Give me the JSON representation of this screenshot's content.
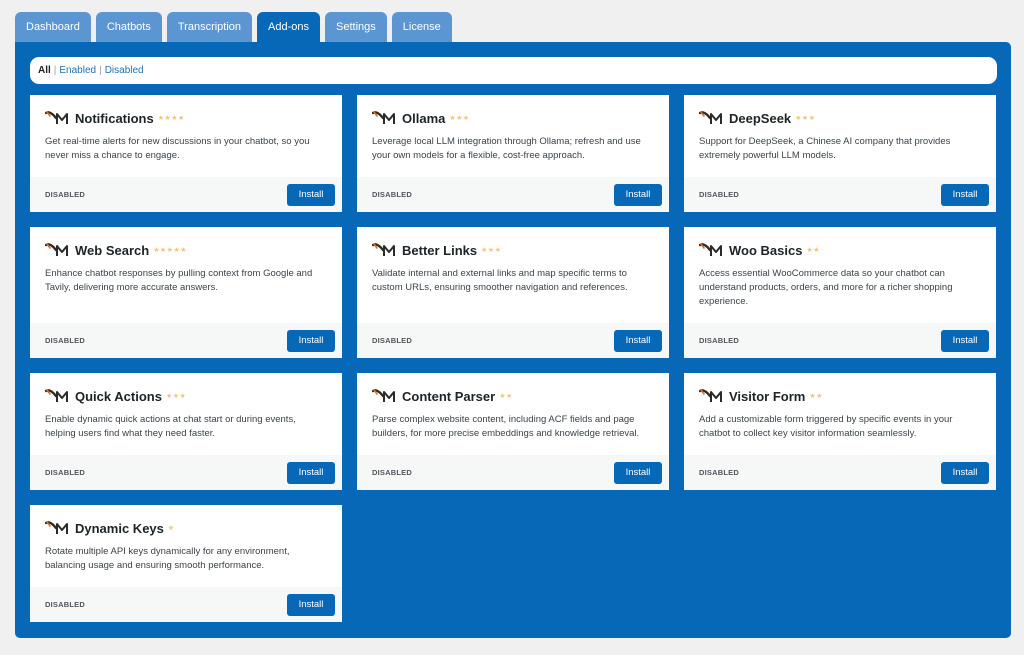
{
  "tabs": [
    {
      "label": "Dashboard",
      "active": false
    },
    {
      "label": "Chatbots",
      "active": false
    },
    {
      "label": "Transcription",
      "active": false
    },
    {
      "label": "Add-ons",
      "active": true
    },
    {
      "label": "Settings",
      "active": false
    },
    {
      "label": "License",
      "active": false
    }
  ],
  "filters": {
    "all": "All",
    "enabled": "Enabled",
    "disabled": "Disabled",
    "separator": "|"
  },
  "colors": {
    "accent": "#0868b8",
    "tab_inactive": "#5b95d2",
    "star": "#f0c674"
  },
  "addons": [
    {
      "title": "Notifications",
      "stars": "★★★★",
      "description": "Get real-time alerts for new discussions in your chatbot, so you never miss a chance to engage.",
      "status": "DISABLED",
      "action": "Install"
    },
    {
      "title": "Ollama",
      "stars": "★★★",
      "description": "Leverage local LLM integration through Ollama; refresh and use your own models for a flexible, cost-free approach.",
      "status": "DISABLED",
      "action": "Install"
    },
    {
      "title": "DeepSeek",
      "stars": "★★★",
      "description": "Support for DeepSeek, a Chinese AI company that provides extremely powerful LLM models.",
      "status": "DISABLED",
      "action": "Install"
    },
    {
      "title": "Web Search",
      "stars": "★★★★★",
      "description": "Enhance chatbot responses by pulling context from Google and Tavily, delivering more accurate answers.",
      "status": "DISABLED",
      "action": "Install"
    },
    {
      "title": "Better Links",
      "stars": "★★★",
      "description": "Validate internal and external links and map specific terms to custom URLs, ensuring smoother navigation and references.",
      "status": "DISABLED",
      "action": "Install"
    },
    {
      "title": "Woo Basics",
      "stars": "★★",
      "description": "Access essential WooCommerce data so your chatbot can understand products, orders, and more for a richer shopping experience.",
      "status": "DISABLED",
      "action": "Install"
    },
    {
      "title": "Quick Actions",
      "stars": "★★★",
      "description": "Enable dynamic quick actions at chat start or during events, helping users find what they need faster.",
      "status": "DISABLED",
      "action": "Install"
    },
    {
      "title": "Content Parser",
      "stars": "★★",
      "description": "Parse complex website content, including ACF fields and page builders, for more precise embeddings and knowledge retrieval.",
      "status": "DISABLED",
      "action": "Install"
    },
    {
      "title": "Visitor Form",
      "stars": "★★",
      "description": "Add a customizable form triggered by specific events in your chatbot to collect key visitor information seamlessly.",
      "status": "DISABLED",
      "action": "Install"
    },
    {
      "title": "Dynamic Keys",
      "stars": "★",
      "description": "Rotate multiple API keys dynamically for any environment, balancing usage and ensuring smooth performance.",
      "status": "DISABLED",
      "action": "Install"
    }
  ]
}
